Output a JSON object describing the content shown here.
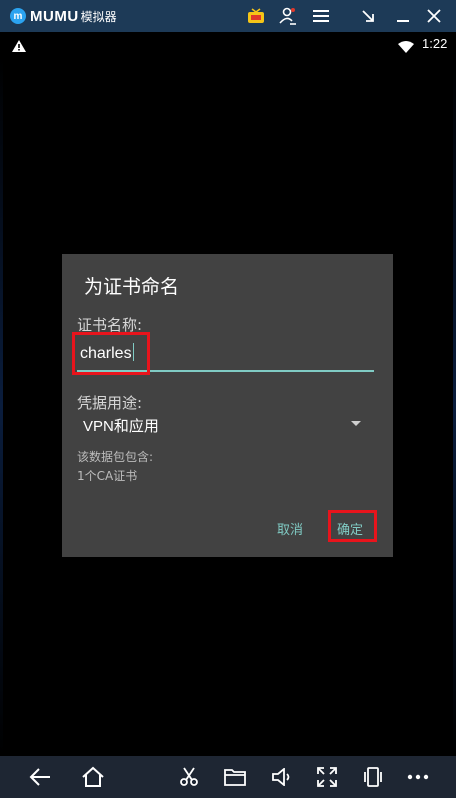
{
  "emulator": {
    "brand_logo": "m",
    "brand_name": "MUMU",
    "brand_suffix": "模拟器",
    "title_icons": [
      "tv-icon",
      "user-icon",
      "menu-icon",
      "minimize-to-corner-icon",
      "minimize-icon",
      "close-icon"
    ]
  },
  "status_bar": {
    "time": "1:22",
    "icons": [
      "warning-icon",
      "wifi-icon"
    ]
  },
  "dialog": {
    "title": "为证书命名",
    "name_label": "证书名称:",
    "name_value": "charles",
    "usage_label": "凭据用途:",
    "usage_value": "VPN和应用",
    "contains_label": "该数据包包含:",
    "contains_value": "1个CA证书",
    "cancel_label": "取消",
    "ok_label": "确定",
    "accent_color": "#80cbc4",
    "highlight_color": "#e8141c"
  },
  "toolbar": {
    "icons": [
      "back-icon",
      "home-icon",
      "cut-icon",
      "folder-icon",
      "volume-icon",
      "fullscreen-icon",
      "rotate-icon",
      "more-icon"
    ]
  }
}
